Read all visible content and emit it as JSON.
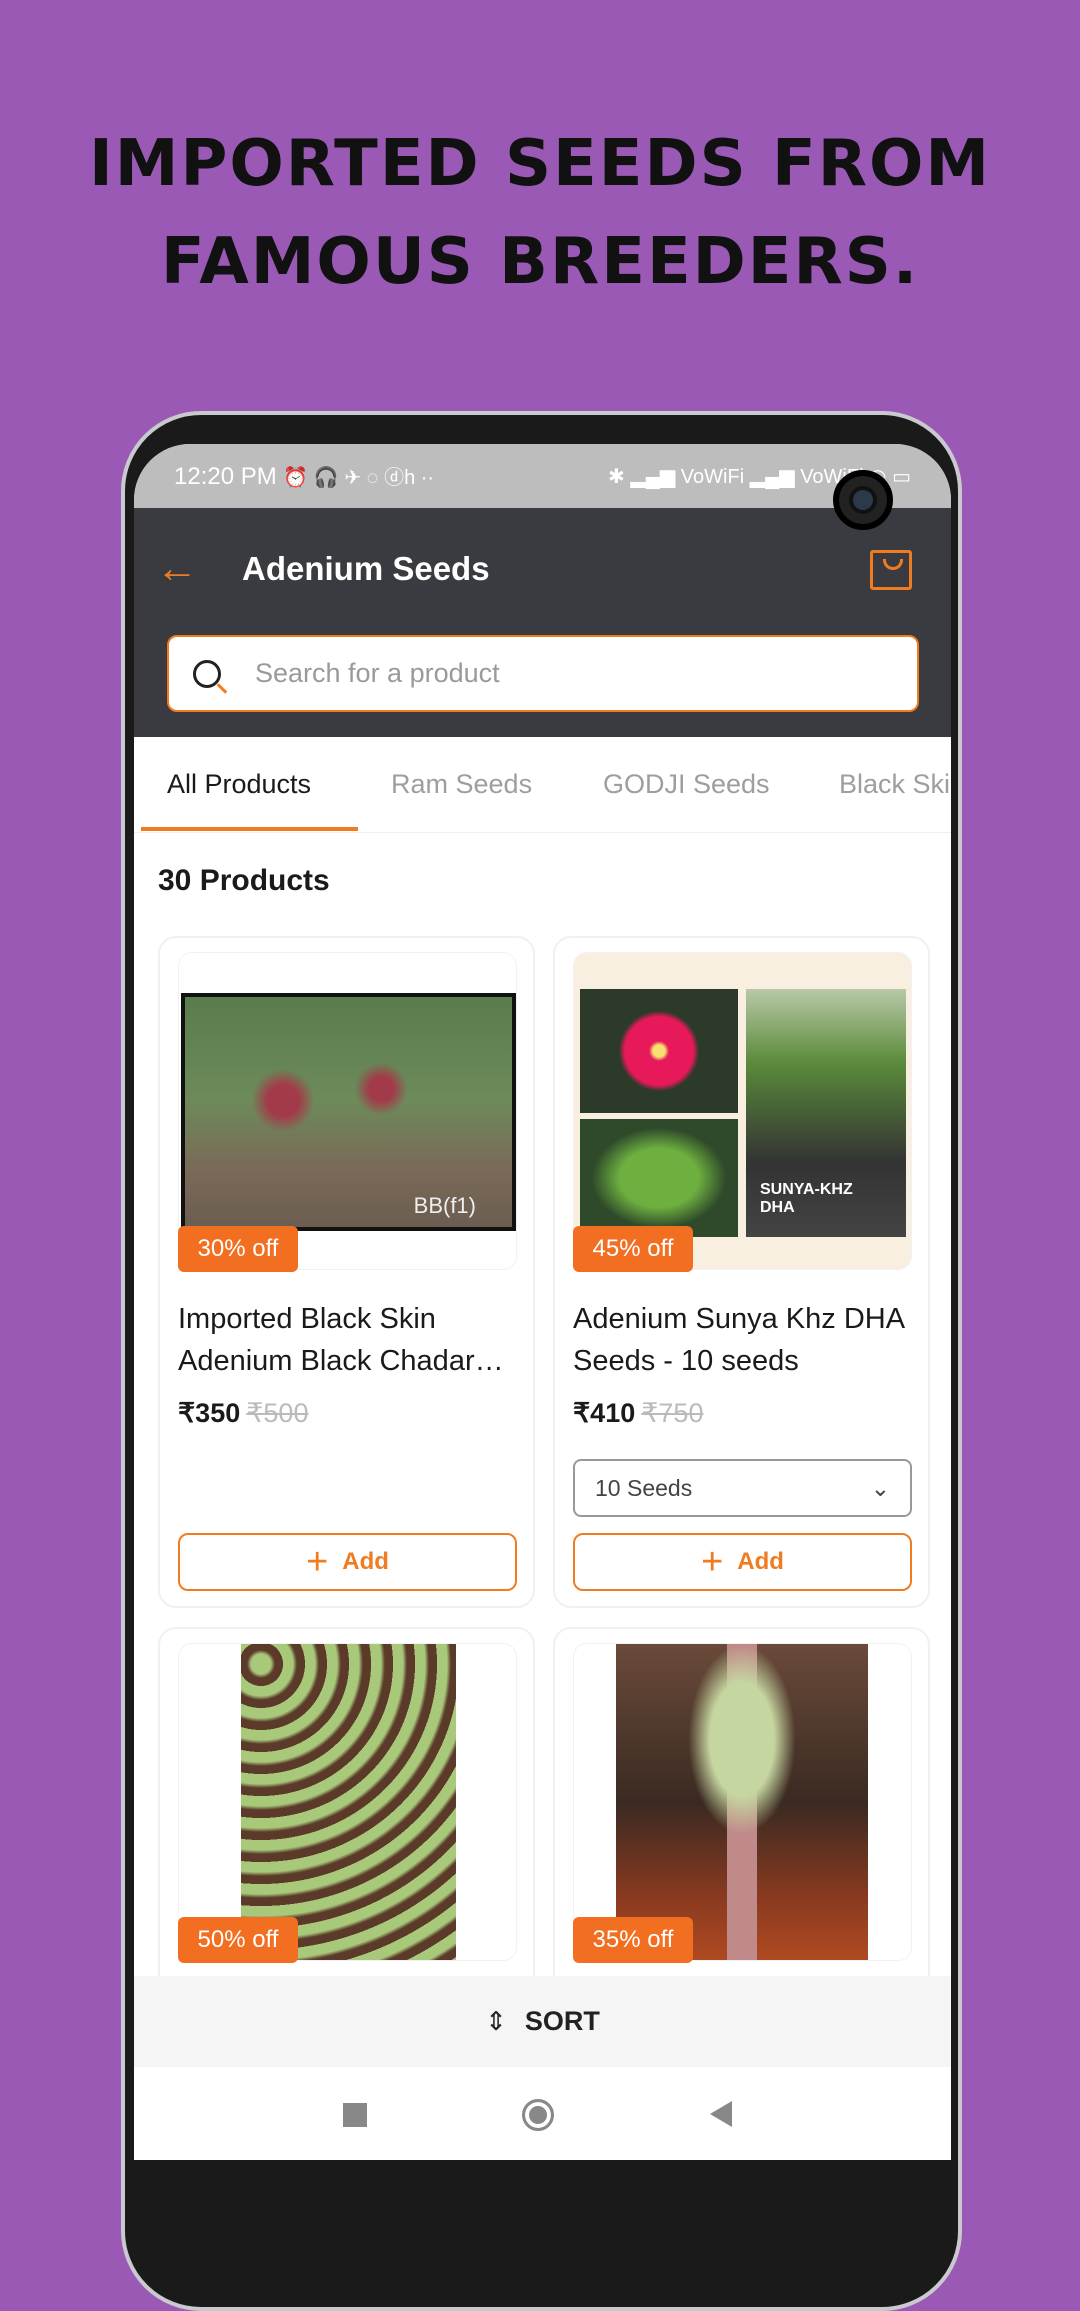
{
  "headline": {
    "line1": "Imported seeds from",
    "line2": "famous breeders."
  },
  "status": {
    "time": "12:20 PM",
    "icons_left": "⏰ 🎧 ✈ ◌ ⓓh ··",
    "icons_right": "✱ ▂▄▆ VoWiFi ▂▄▆ VoWiFi ◠ ▭"
  },
  "header": {
    "title": "Adenium Seeds",
    "back_icon": "arrow-left",
    "cart_icon": "shopping-bag"
  },
  "search": {
    "placeholder": "Search for a product",
    "value": ""
  },
  "tabs": [
    {
      "label": "All Products",
      "active": true
    },
    {
      "label": "Ram Seeds"
    },
    {
      "label": "GODJI Seeds"
    },
    {
      "label": "Black Skin"
    }
  ],
  "product_count": "30 Products",
  "products": [
    {
      "discount": "30% off",
      "name": "Imported Black Skin Adenium Black Chadar Seeds",
      "price": "₹350",
      "mrp": "₹500",
      "image_label": "BB(f1)",
      "add_label": "Add"
    },
    {
      "discount": "45% off",
      "name": "Adenium Sunya Khz DHA Seeds - 10 seeds",
      "price": "₹410",
      "mrp": "₹750",
      "image_label": "SUNYA-KHZ DHA",
      "variant": "10 Seeds",
      "add_label": "Add"
    },
    {
      "discount": "50% off"
    },
    {
      "discount": "35% off"
    }
  ],
  "sort": {
    "label": "SORT"
  },
  "colors": {
    "accent": "#f07c22",
    "badge": "#f26f21",
    "header": "#3a3b40",
    "background": "#9b59b6"
  }
}
